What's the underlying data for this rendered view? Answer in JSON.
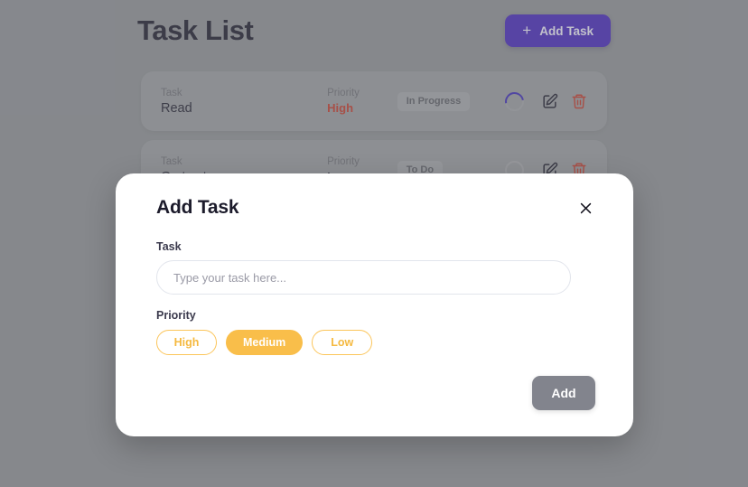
{
  "page": {
    "title": "Task List",
    "add_task_button": "Add Task",
    "plus_icon": "plus-icon"
  },
  "columns": {
    "task_label": "Task",
    "priority_label": "Priority"
  },
  "tasks": [
    {
      "task_label": "Task",
      "name": "Read",
      "priority_label": "Priority",
      "priority": "High",
      "status": "In Progress",
      "progress_state": "partial"
    },
    {
      "task_label": "Task",
      "name": "Go to store",
      "priority_label": "Priority",
      "priority": "Low",
      "status": "To Do",
      "progress_state": "empty"
    }
  ],
  "modal": {
    "title": "Add Task",
    "close_icon": "close-icon",
    "task_field_label": "Task",
    "task_input_value": "",
    "task_input_placeholder": "Type your task here...",
    "priority_field_label": "Priority",
    "priority_options": [
      {
        "label": "High",
        "selected": false
      },
      {
        "label": "Medium",
        "selected": true
      },
      {
        "label": "Low",
        "selected": false
      }
    ],
    "submit_button": "Add"
  },
  "colors": {
    "accent_purple": "#4527b8",
    "amber": "#f9be4a",
    "danger_red": "#c0392b",
    "backdrop_gray": "#8e9094",
    "disabled_gray": "#82848d"
  }
}
